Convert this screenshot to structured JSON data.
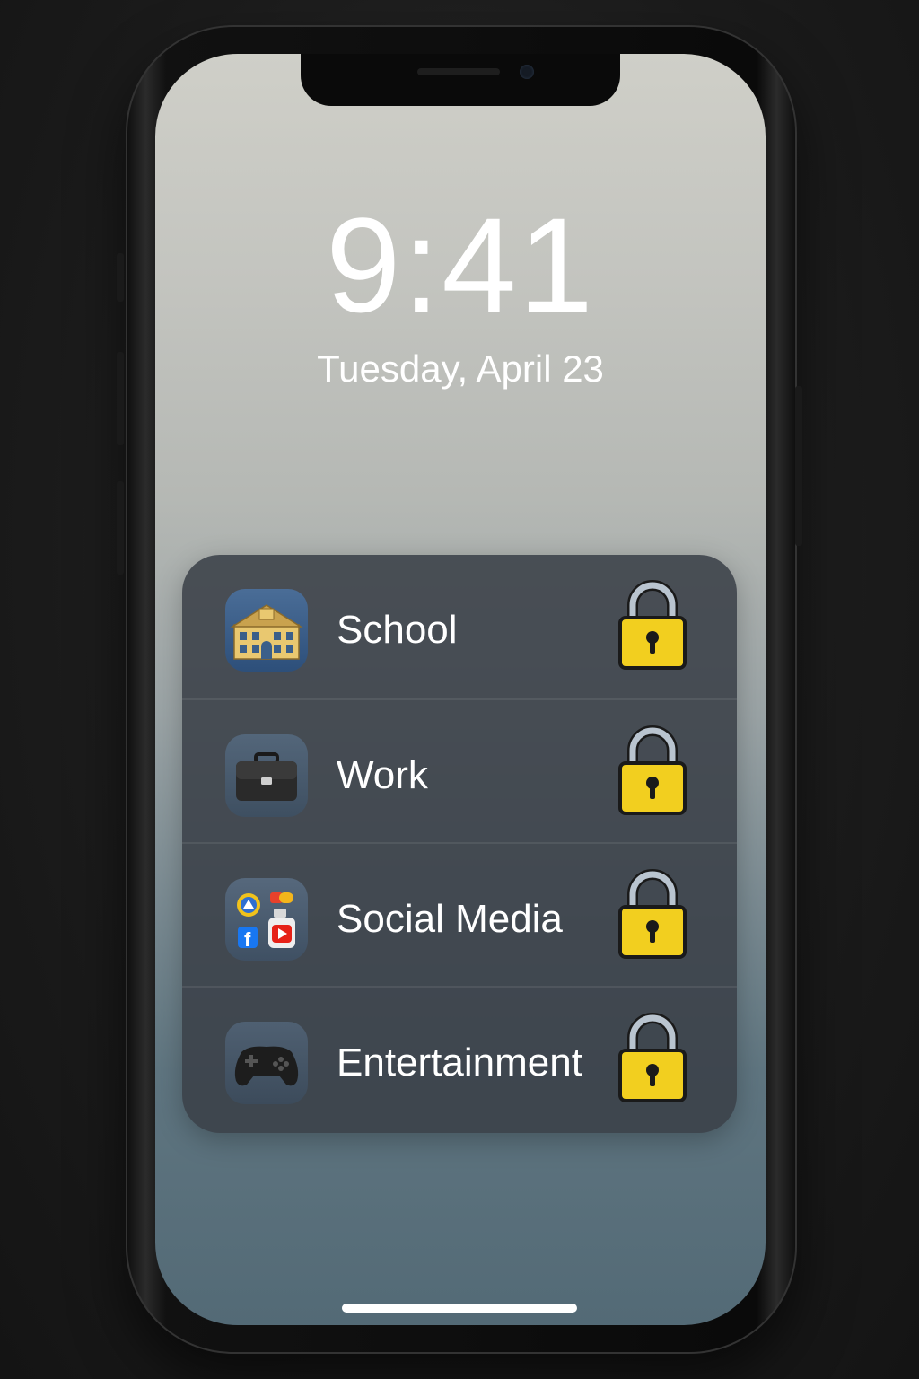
{
  "lockscreen": {
    "time": "9:41",
    "date": "Tuesday, April 23"
  },
  "focus_modes": [
    {
      "label": "School",
      "icon": "school-building-icon",
      "status_icon": "lock-icon"
    },
    {
      "label": "Work",
      "icon": "briefcase-icon",
      "status_icon": "lock-icon"
    },
    {
      "label": "Social Media",
      "icon": "social-apps-icon",
      "status_icon": "lock-icon"
    },
    {
      "label": "Entertainment",
      "icon": "game-controller-icon",
      "status_icon": "lock-icon"
    }
  ],
  "colors": {
    "lock_body": "#f2cf1f",
    "panel": "#3a4048",
    "text": "#ffffff"
  }
}
